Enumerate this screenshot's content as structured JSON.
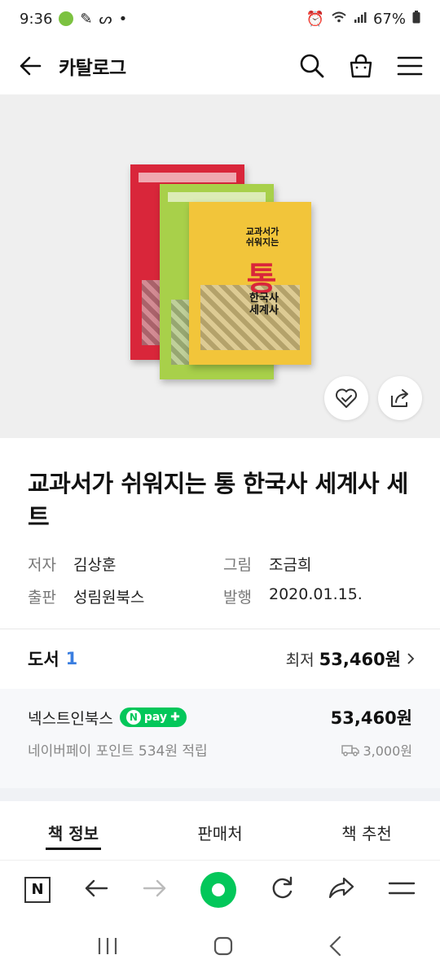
{
  "status_bar": {
    "time": "9:36",
    "battery": "67%"
  },
  "header": {
    "title": "카탈로그"
  },
  "cover": {
    "title_lines": [
      "교과서가",
      "쉬워지는"
    ],
    "brand": "통",
    "subtitle_lines": [
      "한국사",
      "세계사"
    ]
  },
  "product": {
    "title": "교과서가 쉬워지는 통 한국사 세계사 세트",
    "author_label": "저자",
    "author": "김상훈",
    "illustrator_label": "그림",
    "illustrator": "조금희",
    "publisher_label": "출판",
    "publisher": "성림원북스",
    "published_label": "발행",
    "published": "2020.01.15."
  },
  "books_summary": {
    "label": "도서",
    "count": "1",
    "min_label": "최저",
    "min_price": "53,460원"
  },
  "seller": {
    "name": "넥스트인북스",
    "npay": "pay",
    "price": "53,460원",
    "points": "네이버페이 포인트 534원 적립",
    "shipping": "3,000원"
  },
  "tabs": [
    {
      "label": "책 정보"
    },
    {
      "label": "판매처"
    },
    {
      "label": "책 추천"
    }
  ],
  "browser": {
    "n_label": "N"
  },
  "colors": {
    "accent_blue": "#3a7ee0",
    "naver_green": "#03c75a"
  }
}
